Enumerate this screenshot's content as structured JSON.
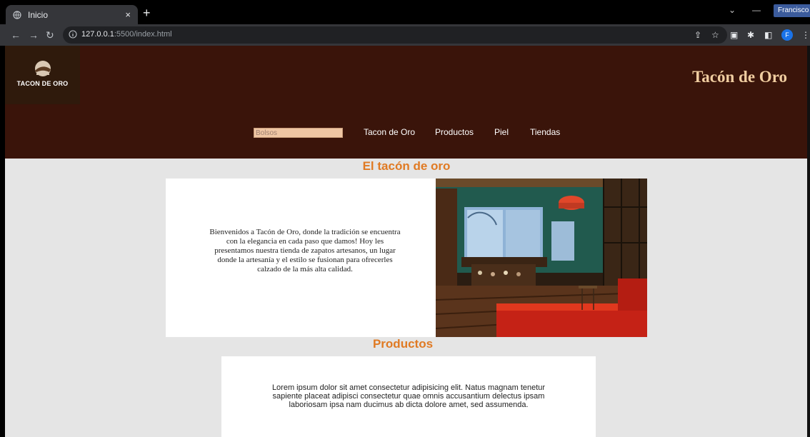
{
  "browser": {
    "tab_title": "Inicio",
    "tab_close": "×",
    "new_tab": "+",
    "profile_name": "Francisco",
    "url_host": "127.0.0.1",
    "url_rest": ":5500/index.html",
    "avatar_letter": "F"
  },
  "header": {
    "logo_text": "TACON DE ORO",
    "site_title": "Tacón de Oro"
  },
  "nav": {
    "search_placeholder": "Bolsos",
    "links": [
      "Tacon de Oro",
      "Productos",
      "Piel",
      "Tiendas"
    ]
  },
  "intro": {
    "title": "El tacón de oro",
    "text": "Bienvenidos a Tacón de Oro, donde la tradición se encuentra con la elegancia en cada paso que damos! Hoy les presentamos nuestra tienda de zapatos artesanos, un lugar donde la artesanía y el estilo se fusionan para ofrecerles calzado de la más alta calidad."
  },
  "products": {
    "title": "Productos",
    "text": "Lorem ipsum dolor sit amet consectetur adipisicing elit. Natus magnam tenetur sapiente placeat adipisci consectetur quae omnis accusantium delectus ipsam laboriosam ipsa nam ducimus ab dicta dolore amet, sed assumenda."
  },
  "colors": {
    "header_bg": "#3a140a",
    "title_gold": "#f0cda0",
    "section_orange": "#e07a23",
    "page_bg": "#e5e5e5"
  }
}
